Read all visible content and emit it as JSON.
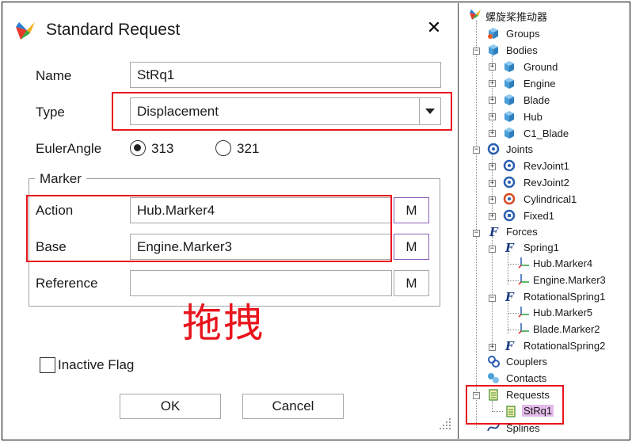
{
  "dialog": {
    "title": "Standard Request",
    "close_glyph": "✕",
    "name_label": "Name",
    "name_value": "StRq1",
    "type_label": "Type",
    "type_value": "Displacement",
    "euler_label": "EulerAngle",
    "euler_options": [
      "313",
      "321"
    ],
    "euler_selected": "313",
    "marker_group_title": "Marker",
    "action_label": "Action",
    "action_value": "Hub.Marker4",
    "base_label": "Base",
    "base_value": "Engine.Marker3",
    "reference_label": "Reference",
    "reference_value": "",
    "m_button_label": "M",
    "drag_annotation": "拖拽",
    "inactive_label": "Inactive Flag",
    "inactive_checked": false,
    "ok_label": "OK",
    "cancel_label": "Cancel"
  },
  "tree": {
    "root": "螺旋桨推动器",
    "items": {
      "groups": "Groups",
      "bodies": "Bodies",
      "ground": "Ground",
      "engine": "Engine",
      "blade": "Blade",
      "hub": "Hub",
      "c1_blade": "C1_Blade",
      "joints": "Joints",
      "revjoint1": "RevJoint1",
      "revjoint2": "RevJoint2",
      "cylindrical1": "Cylindrical1",
      "fixed1": "Fixed1",
      "forces": "Forces",
      "spring1": "Spring1",
      "hub_marker4": "Hub.Marker4",
      "engine_marker3": "Engine.Marker3",
      "rotspring1": "RotationalSpring1",
      "hub_marker5": "Hub.Marker5",
      "blade_marker2": "Blade.Marker2",
      "rotspring2": "RotationalSpring2",
      "couplers": "Couplers",
      "contacts": "Contacts",
      "requests": "Requests",
      "strq1": "StRq1",
      "splines": "Splines"
    },
    "forces_glyph": "F"
  },
  "colors": {
    "highlight_red": "#e8141c",
    "selection_purple": "#e3bbe8",
    "body_cube": "#4a9fd8",
    "joint_icon": "#2a5fb0"
  }
}
